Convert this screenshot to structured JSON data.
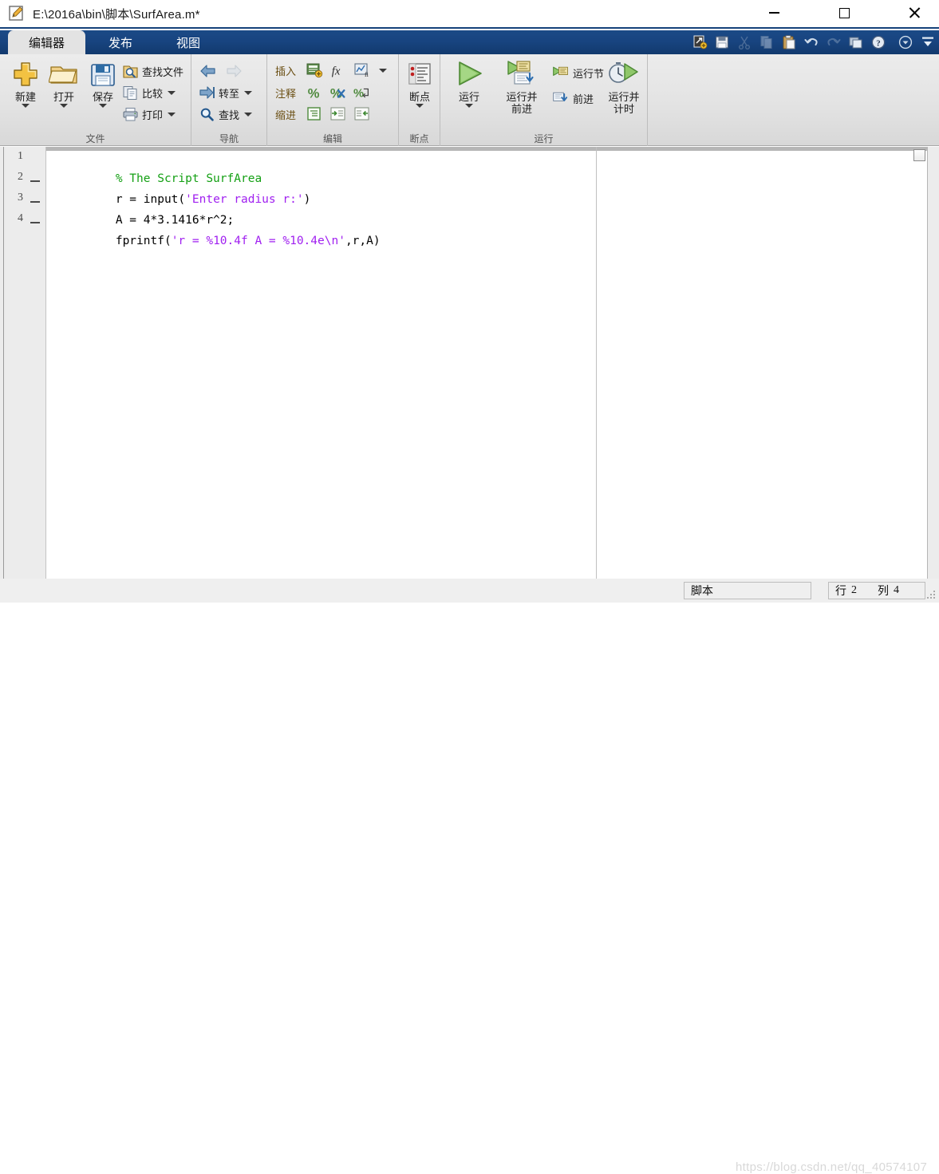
{
  "window": {
    "title": "E:\\2016a\\bin\\脚本\\SurfArea.m*",
    "icon": "editor-document-icon",
    "minimize_label": "−",
    "maximize_label": "□",
    "close_label": "×"
  },
  "tabs": [
    {
      "label": "编辑器",
      "active": true
    },
    {
      "label": "发布",
      "active": false
    },
    {
      "label": "视图",
      "active": false
    }
  ],
  "quick_access": [
    {
      "name": "new-shortcut-icon",
      "enabled": true
    },
    {
      "name": "save-icon",
      "enabled": true
    },
    {
      "name": "cut-icon",
      "enabled": false
    },
    {
      "name": "copy-icon",
      "enabled": false
    },
    {
      "name": "paste-icon",
      "enabled": true
    },
    {
      "name": "undo-icon",
      "enabled": true
    },
    {
      "name": "redo-icon",
      "enabled": false
    },
    {
      "name": "layout-icon",
      "enabled": true
    },
    {
      "name": "help-icon",
      "enabled": true
    },
    {
      "name": "qat-dropdown-icon",
      "enabled": true
    },
    {
      "name": "minimize-ribbon-icon",
      "enabled": true
    }
  ],
  "ribbon": {
    "groups": [
      {
        "label": "文件",
        "big_buttons": [
          {
            "label": "新建",
            "icon": "new-file-icon",
            "has_caret": true
          },
          {
            "label": "打开",
            "icon": "open-folder-icon",
            "has_caret": true
          },
          {
            "label": "保存",
            "icon": "save-disk-icon",
            "has_caret": true
          }
        ],
        "small_buttons": [
          {
            "label": "查找文件",
            "icon": "find-files-icon",
            "has_caret": false
          },
          {
            "label": "比较",
            "icon": "compare-icon",
            "has_caret": true
          },
          {
            "label": "打印",
            "icon": "print-icon",
            "has_caret": true
          }
        ]
      },
      {
        "label": "导航",
        "small_buttons": [
          {
            "label": "",
            "icon": "back-arrow-icon",
            "has_caret": false
          },
          {
            "label": "",
            "icon": "forward-arrow-icon",
            "has_caret": false
          },
          {
            "label": "转至",
            "icon": "go-to-icon",
            "has_caret": true
          },
          {
            "label": "查找",
            "icon": "find-icon",
            "has_caret": true
          }
        ]
      },
      {
        "label": "编辑",
        "rows": [
          {
            "label": "插入",
            "icons": [
              "insert-section-icon",
              "insert-function-icon",
              "insert-figure-icon"
            ],
            "has_caret": true
          },
          {
            "label": "注释",
            "icons": [
              "comment-icon",
              "uncomment-icon",
              "wrap-comment-icon"
            ],
            "has_caret": false
          },
          {
            "label": "缩进",
            "icons": [
              "smart-indent-icon",
              "indent-right-icon",
              "indent-left-icon"
            ],
            "has_caret": false
          }
        ]
      },
      {
        "label": "断点",
        "big_buttons": [
          {
            "label": "断点",
            "icon": "breakpoint-icon",
            "has_caret": true
          }
        ]
      },
      {
        "label": "运行",
        "big_buttons": [
          {
            "label": "运行",
            "icon": "run-icon",
            "has_caret": true
          },
          {
            "label": "运行并\n前进",
            "icon": "run-advance-icon",
            "has_caret": false
          },
          {
            "label": "运行并\n计时",
            "icon": "run-time-icon",
            "has_caret": false
          }
        ],
        "small_buttons": [
          {
            "label": "运行节",
            "icon": "run-section-icon",
            "has_caret": false
          },
          {
            "label": "前进",
            "icon": "advance-icon",
            "has_caret": false
          }
        ]
      }
    ]
  },
  "editor": {
    "lines": [
      {
        "number": "1",
        "executable": false,
        "tokens": [
          {
            "text": "% The Script SurfArea",
            "type": "comment"
          }
        ]
      },
      {
        "number": "2",
        "executable": true,
        "tokens": [
          {
            "text": "r = input(",
            "type": "plain"
          },
          {
            "text": "'Enter radius r:'",
            "type": "string"
          },
          {
            "text": ")",
            "type": "plain"
          }
        ]
      },
      {
        "number": "3",
        "executable": true,
        "tokens": [
          {
            "text": "A = 4*3.1416*r^2;",
            "type": "plain"
          }
        ]
      },
      {
        "number": "4",
        "executable": true,
        "tokens": [
          {
            "text": "fprintf(",
            "type": "plain"
          },
          {
            "text": "'r = %10.4f A = %10.4e\\n'",
            "type": "string"
          },
          {
            "text": ",r,A)",
            "type": "plain"
          }
        ]
      }
    ]
  },
  "status": {
    "file_type": "脚本",
    "line_label": "行",
    "line_value": "2",
    "column_label": "列",
    "column_value": "4",
    "watermark": "https://blog.csdn.net/qq_40574107"
  },
  "colors": {
    "titlebar_accent": "#15427a",
    "tab_blue": "#184480",
    "ribbon_bg": "#e3e3e3",
    "comment_green": "#14a014",
    "string_purple": "#a020f0"
  }
}
